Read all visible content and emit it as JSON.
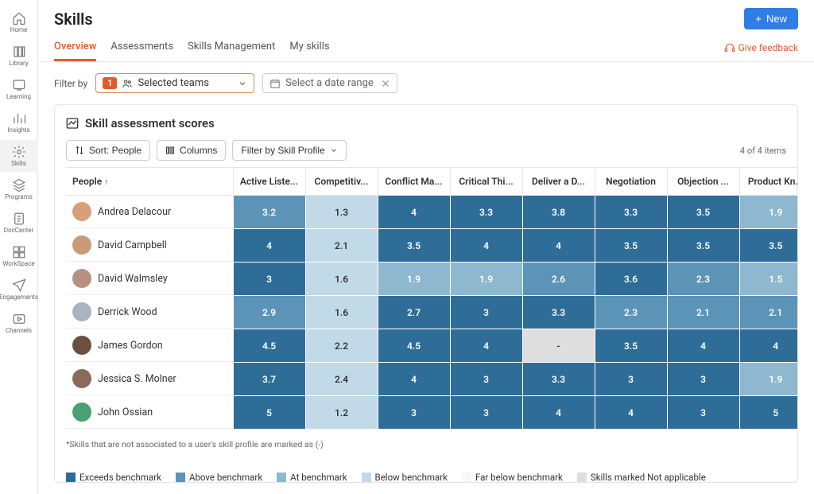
{
  "page_title": "Skills",
  "new_button": "New",
  "tabs": [
    "Overview",
    "Assessments",
    "Skills Management",
    "My skills"
  ],
  "active_tab": "Overview",
  "feedback_label": "Give feedback",
  "filter_label": "Filter by",
  "team_filter": {
    "count": "1",
    "text": "Selected teams"
  },
  "date_filter": {
    "placeholder": "Select a date range"
  },
  "card_title": "Skill assessment scores",
  "sort_btn": "Sort: People",
  "columns_btn": "Columns",
  "profile_filter_btn": "Filter by Skill Profile",
  "item_count": "4 of 4 items",
  "people_header": "People",
  "skill_headers": [
    "Active Liste...",
    "Competitiv...",
    "Conflict Ma...",
    "Critical Thi...",
    "Deliver a D...",
    "Negotiation",
    "Objection ...",
    "Product Kn..."
  ],
  "rows": [
    {
      "name": "Andrea Delacour",
      "avatar": "#d8a07a",
      "scores": [
        {
          "v": "3.2",
          "c": "c-above"
        },
        {
          "v": "1.3",
          "c": "c-below"
        },
        {
          "v": "4",
          "c": "c-exceeds"
        },
        {
          "v": "3.3",
          "c": "c-exceeds"
        },
        {
          "v": "3.8",
          "c": "c-exceeds"
        },
        {
          "v": "3.3",
          "c": "c-exceeds"
        },
        {
          "v": "3.5",
          "c": "c-exceeds"
        },
        {
          "v": "1.9",
          "c": "c-at"
        }
      ]
    },
    {
      "name": "David Campbell",
      "avatar": "#c99a7a",
      "scores": [
        {
          "v": "4",
          "c": "c-exceeds"
        },
        {
          "v": "2.1",
          "c": "c-below"
        },
        {
          "v": "3.5",
          "c": "c-exceeds"
        },
        {
          "v": "4",
          "c": "c-exceeds"
        },
        {
          "v": "4",
          "c": "c-exceeds"
        },
        {
          "v": "3.5",
          "c": "c-exceeds"
        },
        {
          "v": "3.5",
          "c": "c-exceeds"
        },
        {
          "v": "3.5",
          "c": "c-exceeds"
        }
      ]
    },
    {
      "name": "David Walmsley",
      "avatar": "#b69080",
      "scores": [
        {
          "v": "3",
          "c": "c-exceeds"
        },
        {
          "v": "1.6",
          "c": "c-below"
        },
        {
          "v": "1.9",
          "c": "c-at"
        },
        {
          "v": "1.9",
          "c": "c-at"
        },
        {
          "v": "2.6",
          "c": "c-above"
        },
        {
          "v": "3.6",
          "c": "c-exceeds"
        },
        {
          "v": "2.3",
          "c": "c-above"
        },
        {
          "v": "1.5",
          "c": "c-at"
        }
      ]
    },
    {
      "name": "Derrick Wood",
      "avatar": "#a8b5c0",
      "scores": [
        {
          "v": "2.9",
          "c": "c-above"
        },
        {
          "v": "1.6",
          "c": "c-below"
        },
        {
          "v": "2.7",
          "c": "c-exceeds"
        },
        {
          "v": "3",
          "c": "c-exceeds"
        },
        {
          "v": "3.3",
          "c": "c-exceeds"
        },
        {
          "v": "2.3",
          "c": "c-above"
        },
        {
          "v": "2.1",
          "c": "c-above"
        },
        {
          "v": "2.1",
          "c": "c-above"
        }
      ]
    },
    {
      "name": "James Gordon",
      "avatar": "#6b5040",
      "scores": [
        {
          "v": "4.5",
          "c": "c-exceeds"
        },
        {
          "v": "2.2",
          "c": "c-below"
        },
        {
          "v": "4.5",
          "c": "c-exceeds"
        },
        {
          "v": "4",
          "c": "c-exceeds"
        },
        {
          "v": "-",
          "c": "c-na"
        },
        {
          "v": "3.5",
          "c": "c-exceeds"
        },
        {
          "v": "4",
          "c": "c-exceeds"
        },
        {
          "v": "4",
          "c": "c-exceeds"
        }
      ]
    },
    {
      "name": "Jessica S. Molner",
      "avatar": "#8a6a5a",
      "scores": [
        {
          "v": "3.7",
          "c": "c-exceeds"
        },
        {
          "v": "2.4",
          "c": "c-below"
        },
        {
          "v": "4",
          "c": "c-exceeds"
        },
        {
          "v": "3",
          "c": "c-exceeds"
        },
        {
          "v": "3.3",
          "c": "c-exceeds"
        },
        {
          "v": "3",
          "c": "c-exceeds"
        },
        {
          "v": "3",
          "c": "c-exceeds"
        },
        {
          "v": "1.9",
          "c": "c-at"
        }
      ]
    },
    {
      "name": "John Ossian",
      "avatar": "#4aa070",
      "scores": [
        {
          "v": "5",
          "c": "c-exceeds"
        },
        {
          "v": "1.2",
          "c": "c-below"
        },
        {
          "v": "3",
          "c": "c-exceeds"
        },
        {
          "v": "3",
          "c": "c-exceeds"
        },
        {
          "v": "4",
          "c": "c-exceeds"
        },
        {
          "v": "4",
          "c": "c-exceeds"
        },
        {
          "v": "3",
          "c": "c-exceeds"
        },
        {
          "v": "5",
          "c": "c-exceeds"
        }
      ]
    }
  ],
  "footnote": "*Skills that are not associated to a user's skill profile are marked as (-)",
  "legend": [
    {
      "label": "Exceeds benchmark",
      "c": "c-exceeds"
    },
    {
      "label": "Above benchmark",
      "c": "c-above"
    },
    {
      "label": "At benchmark",
      "c": "c-at"
    },
    {
      "label": "Below benchmark",
      "c": "c-below"
    },
    {
      "label": "Far below benchmark",
      "c": "c-farbelow"
    },
    {
      "label": "Skills marked Not applicable",
      "c": "c-na"
    }
  ],
  "sidebar": [
    {
      "label": "Home",
      "icon": "home"
    },
    {
      "label": "Library",
      "icon": "library"
    },
    {
      "label": "Learning",
      "icon": "learning"
    },
    {
      "label": "Insights",
      "icon": "insights"
    },
    {
      "label": "Skills",
      "icon": "skills",
      "active": true
    },
    {
      "label": "Programs",
      "icon": "programs"
    },
    {
      "label": "DocCenter",
      "icon": "doccenter"
    },
    {
      "label": "WorkSpace",
      "icon": "workspace"
    },
    {
      "label": "Engagements",
      "icon": "engagements"
    },
    {
      "label": "Channels",
      "icon": "channels"
    }
  ]
}
